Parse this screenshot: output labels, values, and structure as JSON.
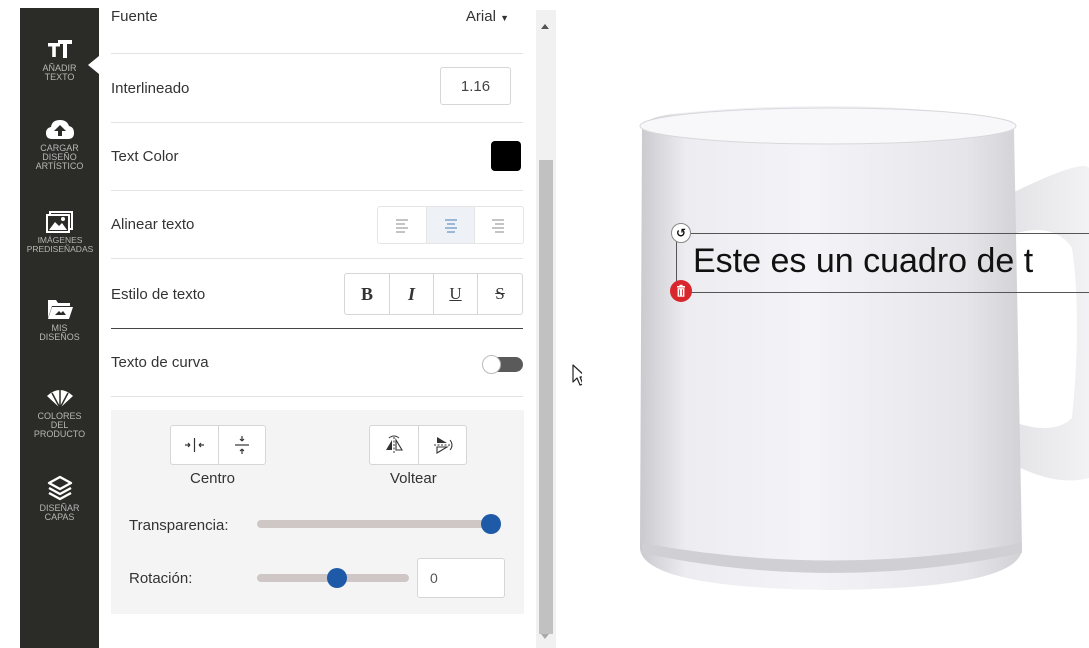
{
  "sidebar": {
    "items": [
      {
        "label_1": "AÑADIR",
        "label_2": "TEXTO",
        "icon": "text-icon"
      },
      {
        "label_1": "CARGAR",
        "label_2": "DISEÑO",
        "label_3": "ARTÍSTICO",
        "icon": "cloud-upload-icon"
      },
      {
        "label_1": "IMÁGENES",
        "label_2": "PREDISEÑADAS",
        "icon": "image-icon"
      },
      {
        "label_1": "MIS",
        "label_2": "DISEÑOS",
        "icon": "folder-icon"
      },
      {
        "label_1": "COLORES",
        "label_2": "DEL",
        "label_3": "PRODUCTO",
        "icon": "palette-icon"
      },
      {
        "label_1": "DISEÑAR",
        "label_2": "CAPAS",
        "icon": "layers-icon"
      }
    ]
  },
  "panel": {
    "font_label": "Fuente",
    "font_value": "Arial",
    "line_height_label": "Interlineado",
    "line_height_value": "1.16",
    "text_color_label": "Text Color",
    "text_color_value": "#000000",
    "align_label": "Alinear texto",
    "align_options": [
      "left",
      "center",
      "right"
    ],
    "align_selected": "center",
    "style_label": "Estilo de texto",
    "style_buttons": [
      "B",
      "I",
      "U",
      "S"
    ],
    "curve_label": "Texto de curva",
    "curve_on": false,
    "center_label": "Centro",
    "flip_label": "Voltear",
    "transparency_label": "Transparencia:",
    "transparency_value": 1.0,
    "rotation_label": "Rotación:",
    "rotation_value": "0",
    "rotation_slider_fraction": 0.5
  },
  "canvas": {
    "text_box": "Este es un cuadro de t",
    "accent": "#1e5aa8",
    "delete_color": "#d9262c"
  }
}
